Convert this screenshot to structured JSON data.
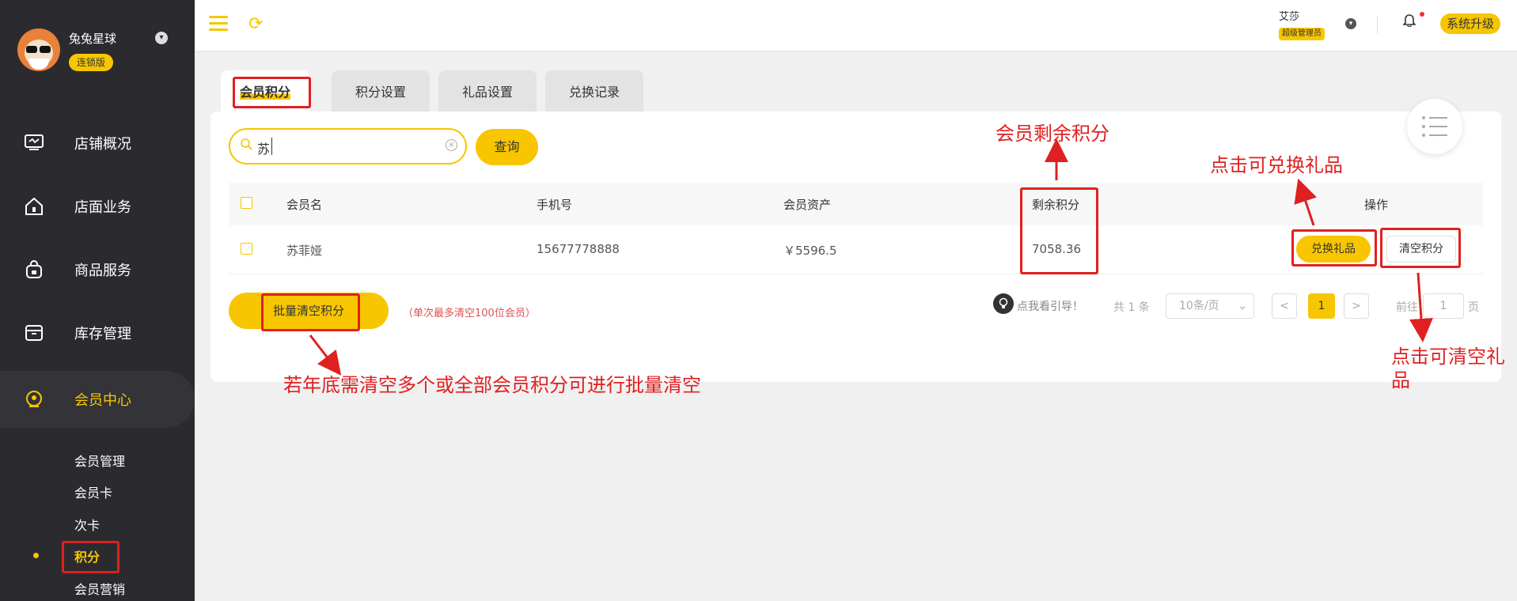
{
  "sidebar": {
    "store_name": "兔兔星球",
    "store_badge": "连锁版",
    "nav": [
      {
        "label": "店铺概况",
        "icon": "monitor-icon"
      },
      {
        "label": "店面业务",
        "icon": "home-icon"
      },
      {
        "label": "商品服务",
        "icon": "bag-icon"
      },
      {
        "label": "库存管理",
        "icon": "archive-icon"
      },
      {
        "label": "会员中心",
        "icon": "member-icon"
      }
    ],
    "sub": [
      "会员管理",
      "会员卡",
      "次卡",
      "积分",
      "会员营销"
    ]
  },
  "topbar": {
    "user_name": "艾莎",
    "user_role": "超级管理员",
    "upgrade": "系统升级"
  },
  "tabs": [
    "会员积分",
    "积分设置",
    "礼品设置",
    "兑换记录"
  ],
  "search": {
    "value": "苏",
    "button": "查询"
  },
  "table": {
    "headers": [
      "会员名",
      "手机号",
      "会员资产",
      "剩余积分",
      "操作"
    ],
    "rows": [
      {
        "name": "苏菲娅",
        "phone": "15677778888",
        "assets": "￥5596.5",
        "points": "7058.36",
        "action_exchange": "兑换礼品",
        "action_clear": "清空积分"
      }
    ]
  },
  "footer": {
    "batch_button": "批量清空积分",
    "batch_note": "（单次最多清空100位会员）",
    "guide": "点我看引导！",
    "total": "共 1 条",
    "page_size": "10条/页",
    "prev": "<",
    "current_page": "1",
    "next": ">",
    "goto_label": "前往",
    "goto_value": "1",
    "page_unit": "页"
  },
  "annotations": {
    "remaining_points": "会员剩余积分",
    "exchange_hint": "点击可兑换礼品",
    "clear_hint_1": "点击可清空礼",
    "clear_hint_2": "品",
    "batch_hint": "若年底需清空多个或全部会员积分可进行批量清空"
  },
  "colors": {
    "accent": "#f7c600",
    "sidebar": "#2b2b2f",
    "annotation": "#e02020"
  }
}
